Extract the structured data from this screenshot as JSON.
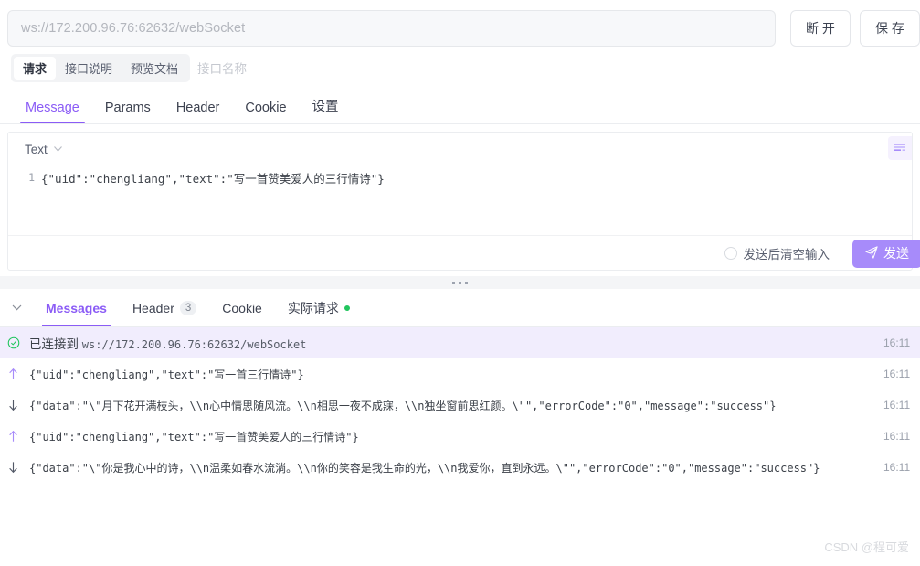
{
  "topbar": {
    "url_placeholder": "ws://172.200.96.76:62632/webSocket",
    "url_value": "",
    "disconnect_label": "断 开",
    "save_label": "保 存"
  },
  "segmented": {
    "items": [
      {
        "label": "请求",
        "active": true
      },
      {
        "label": "接口说明",
        "active": false
      },
      {
        "label": "预览文档",
        "active": false
      }
    ],
    "api_name_placeholder": "接口名称"
  },
  "tabs": [
    {
      "label": "Message",
      "active": true
    },
    {
      "label": "Params",
      "active": false
    },
    {
      "label": "Header",
      "active": false
    },
    {
      "label": "Cookie",
      "active": false
    },
    {
      "label": "设置",
      "active": false
    }
  ],
  "editor": {
    "type_label": "Text",
    "format_icon": "format-code-icon",
    "line_number": "1",
    "content": "{\"uid\":\"chengliang\",\"text\":\"写一首赞美爱人的三行情诗\"}"
  },
  "send_bar": {
    "clear_after_send_label": "发送后清空输入",
    "clear_after_send_checked": false,
    "send_label": "发送",
    "send_icon": "paper-plane-icon"
  },
  "bottom_tabs": [
    {
      "label": "Messages",
      "active": true,
      "badge": "",
      "dot": false
    },
    {
      "label": "Header",
      "active": false,
      "badge": "3",
      "dot": false
    },
    {
      "label": "Cookie",
      "active": false,
      "badge": "",
      "dot": false
    },
    {
      "label": "实际请求",
      "active": false,
      "badge": "",
      "dot": true
    }
  ],
  "messages": [
    {
      "kind": "connected",
      "icon": "circle-check-icon",
      "label": "已连接到",
      "url": "ws://172.200.96.76:62632/webSocket",
      "time": "16:11"
    },
    {
      "kind": "sent",
      "icon": "arrow-up-icon",
      "text": "{\"uid\":\"chengliang\",\"text\":\"写一首三行情诗\"}",
      "time": "16:11"
    },
    {
      "kind": "received",
      "icon": "arrow-down-icon",
      "text": "{\"data\":\"\\\"月下花开满枝头，\\\\n心中情思随风流。\\\\n相思一夜不成寐，\\\\n独坐窗前思红颜。\\\"\",\"errorCode\":\"0\",\"message\":\"success\"}",
      "time": "16:11"
    },
    {
      "kind": "sent",
      "icon": "arrow-up-icon",
      "text": "{\"uid\":\"chengliang\",\"text\":\"写一首赞美爱人的三行情诗\"}",
      "time": "16:11"
    },
    {
      "kind": "received",
      "icon": "arrow-down-icon",
      "text": "{\"data\":\"\\\"你是我心中的诗，\\\\n温柔如春水流淌。\\\\n你的笑容是我生命的光，\\\\n我爱你，直到永远。\\\"\",\"errorCode\":\"0\",\"message\":\"success\"}",
      "time": "16:11"
    }
  ],
  "watermark": "CSDN @程可爱",
  "colors": {
    "accent": "#8b5cf6",
    "send_button": "#a78bfa",
    "success": "#22c55e",
    "connected_row_bg": "#f1edfd"
  }
}
